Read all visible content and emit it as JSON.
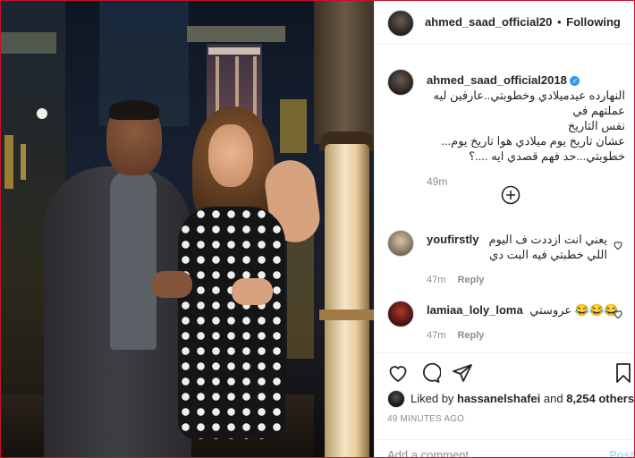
{
  "post": {
    "account": "ahmed_saad_official20",
    "separator": "•",
    "follow_state": "Following"
  },
  "caption": {
    "author": "ahmed_saad_official2018",
    "line1": "النهارده عيد",
    "line2": "ميلادي وخطوبتي..عارفين ليه عملتهم في",
    "line3": "نفس التاريخ",
    "line4": "عشان تاريخ يوم ميلادي هوا تاريخ يوم...",
    "line5": "خطوبتي...حد فهم قصدي ايه ....؟",
    "time": "49m"
  },
  "comments": [
    {
      "user": "youfirstly",
      "text1": "يعني انت ازددت ف اليوم",
      "text2": "اللي خطبتي فيه البت دي",
      "time": "47m",
      "reply": "Reply"
    },
    {
      "user": "lamiaa_loly_loma",
      "text1": "عروستي 😂😂😂",
      "time": "47m",
      "reply": "Reply"
    }
  ],
  "likes": {
    "prefix": "Liked by",
    "user": "hassanelshafei",
    "and": "and",
    "count": "8,254 others"
  },
  "timestamp": "49 MINUTES AGO",
  "add_comment": {
    "placeholder": "Add a comment…",
    "post_label": "Post"
  },
  "icons": [
    "heart-icon",
    "comment-icon",
    "share-icon",
    "bookmark-icon",
    "add-circle-icon",
    "verified-icon"
  ],
  "colors": {
    "verified": "#3897f0",
    "muted": "#8e8e8e",
    "post_button_disabled": "#b3dbff",
    "frame_border": "#c8102e"
  }
}
